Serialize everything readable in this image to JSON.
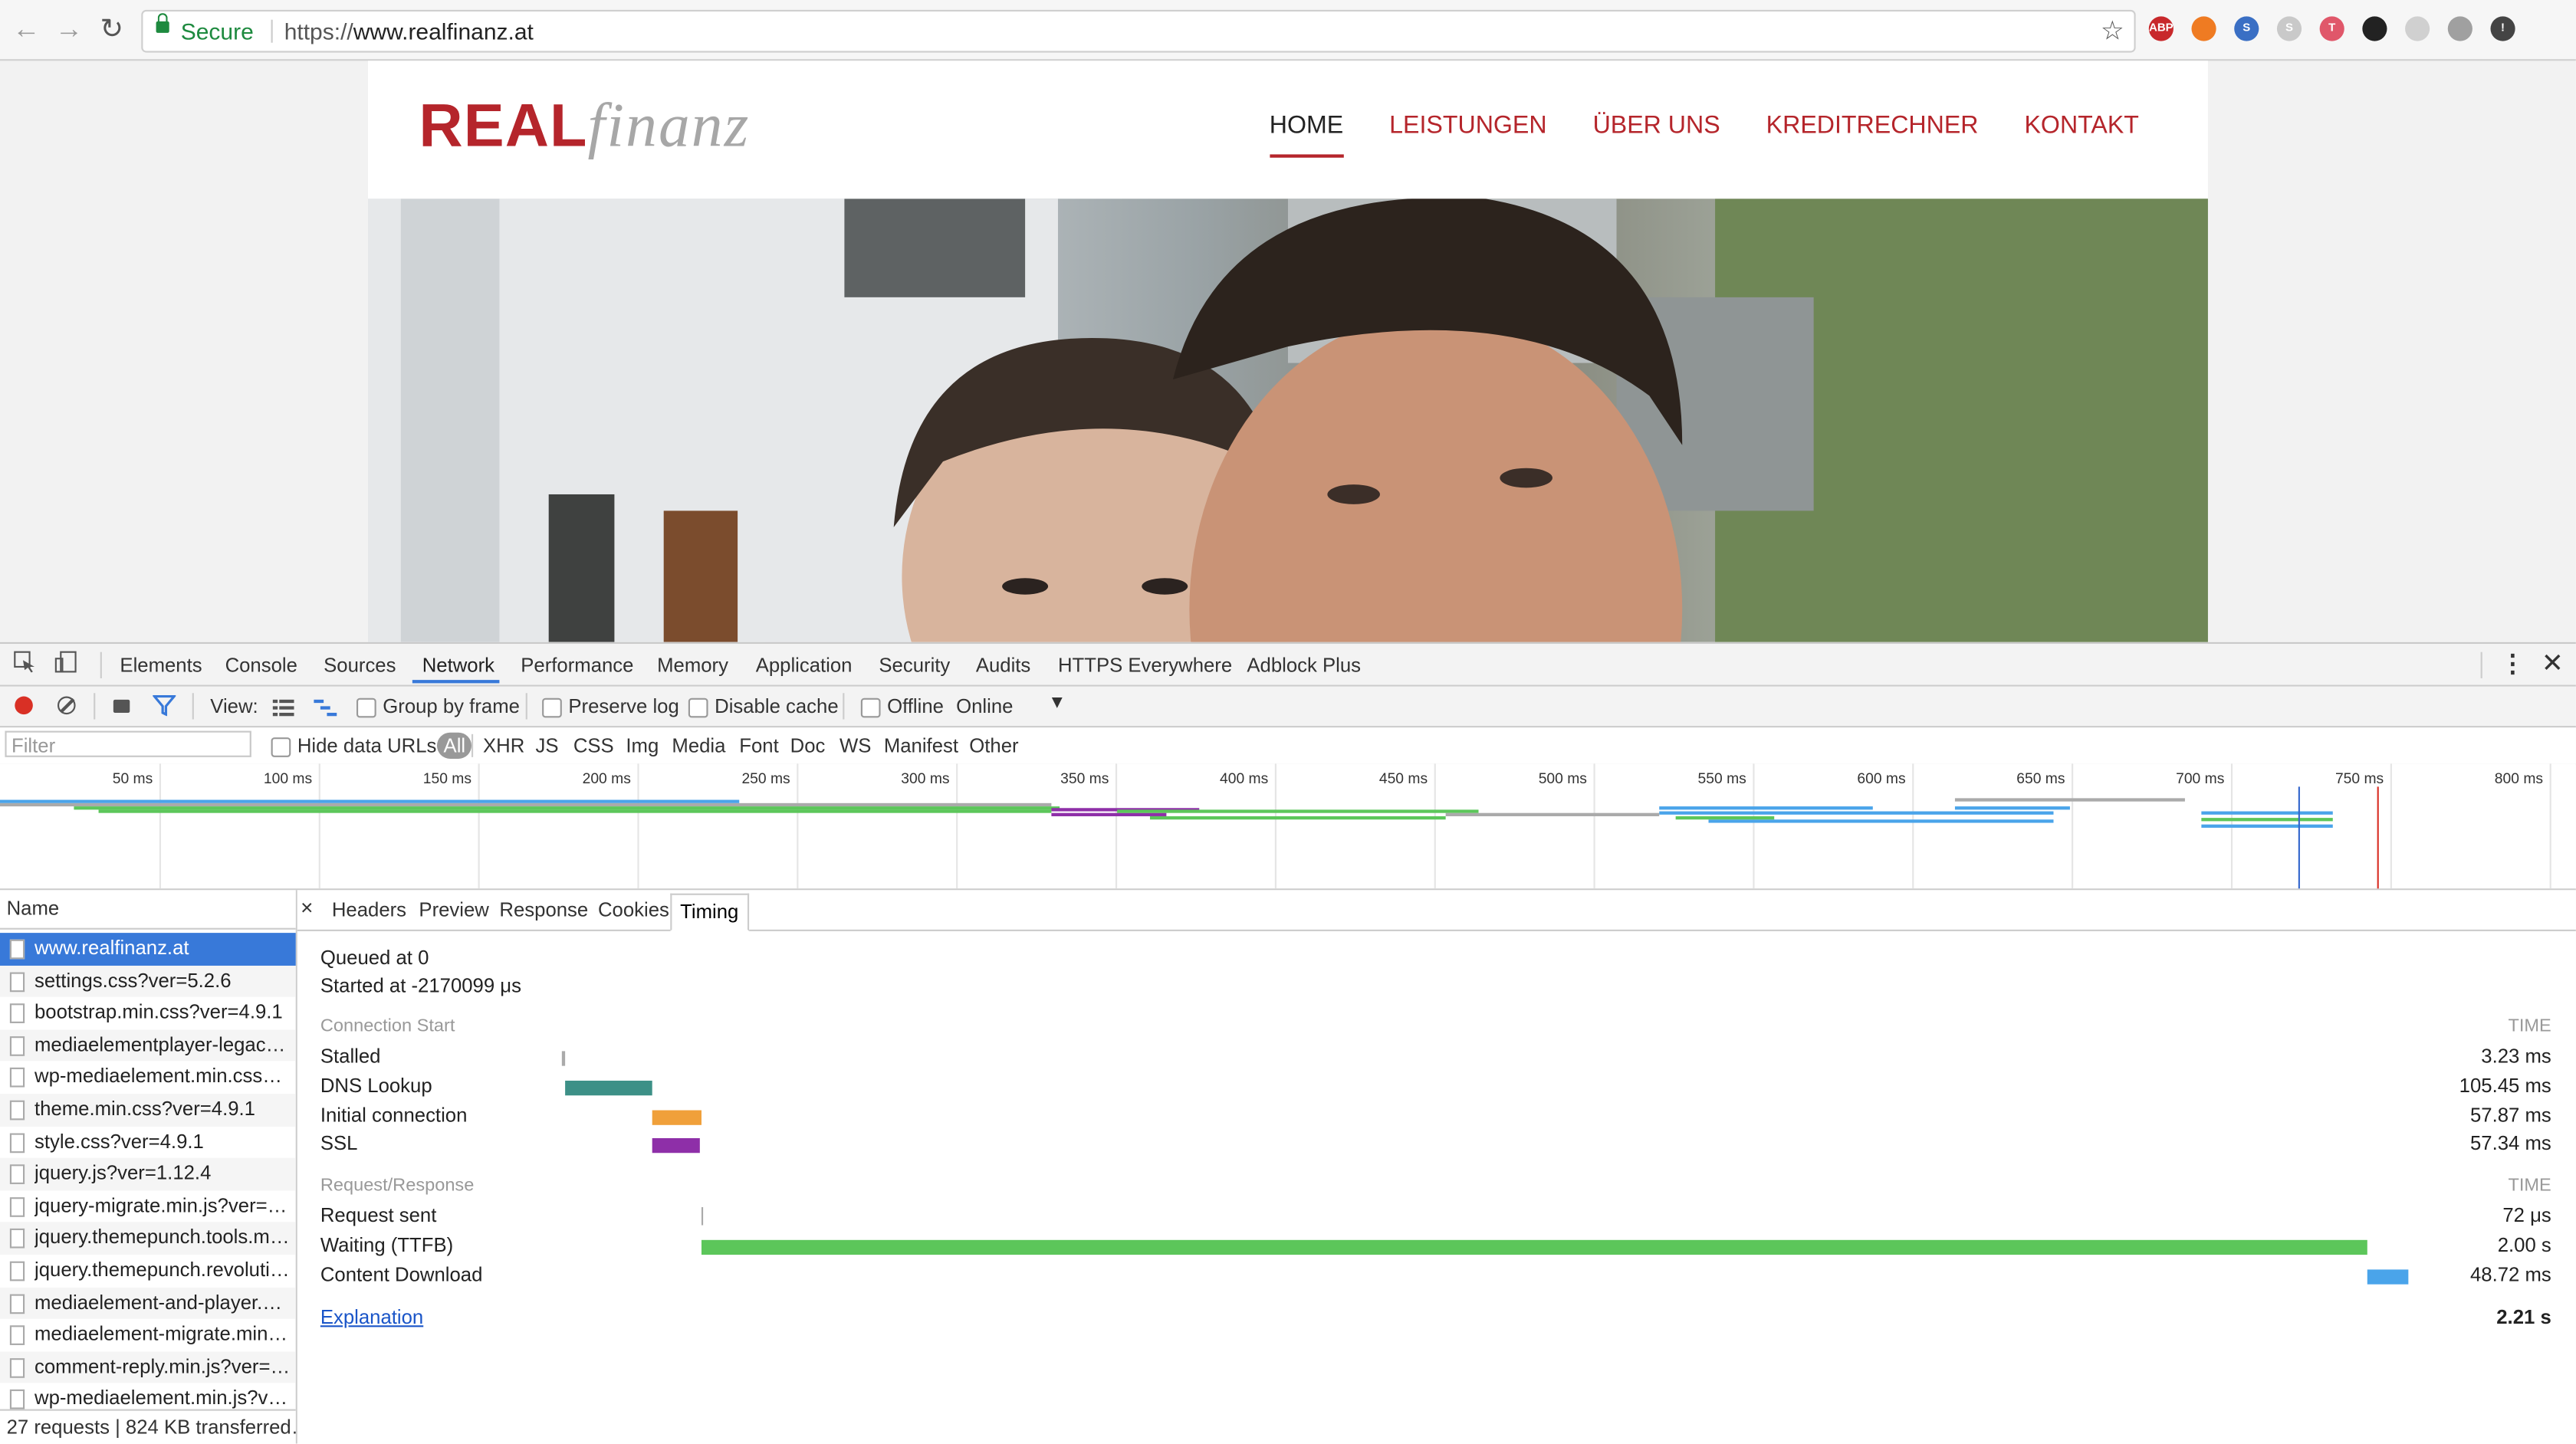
{
  "browser": {
    "secure_label": "Secure",
    "url_protocol": "https://",
    "url_host": "www.realfinanz.at",
    "extensions": [
      {
        "name": "abp-icon",
        "label": "ABP",
        "color": "#c8282b"
      },
      {
        "name": "extension-orange-icon",
        "label": "",
        "color": "#ef7b22"
      },
      {
        "name": "extension-s-icon",
        "label": "S",
        "color": "#3a6fc4"
      },
      {
        "name": "extension-skype-icon",
        "label": "S",
        "color": "#c9c9c9"
      },
      {
        "name": "extension-t-icon",
        "label": "T",
        "color": "#e0576a"
      },
      {
        "name": "extension-fox-icon",
        "label": "",
        "color": "#222222"
      },
      {
        "name": "extension-grid-icon",
        "label": "",
        "color": "#d0d0d0"
      },
      {
        "name": "extension-gear-icon",
        "label": "",
        "color": "#a0a0a0"
      },
      {
        "name": "extension-info-icon",
        "label": "!",
        "color": "#444444"
      }
    ]
  },
  "site": {
    "logo_bold": "REAL",
    "logo_light": "finanz",
    "nav": [
      "HOME",
      "LEISTUNGEN",
      "ÜBER UNS",
      "KREDITRECHNER",
      "KONTAKT"
    ],
    "accent": "#b5252b"
  },
  "devtools": {
    "tabs": [
      "Elements",
      "Console",
      "Sources",
      "Network",
      "Performance",
      "Memory",
      "Application",
      "Security",
      "Audits",
      "HTTPS Everywhere",
      "Adblock Plus"
    ],
    "active_tab": "Network",
    "toolbar": {
      "view_label": "View:",
      "group_by_frame": "Group by frame",
      "preserve_log": "Preserve log",
      "disable_cache": "Disable cache",
      "offline": "Offline",
      "throttle": "Online"
    },
    "filter": {
      "placeholder": "Filter",
      "hide_data_urls": "Hide data URLs",
      "types": [
        "All",
        "XHR",
        "JS",
        "CSS",
        "Img",
        "Media",
        "Font",
        "Doc",
        "WS",
        "Manifest",
        "Other"
      ]
    },
    "overview_ticks": [
      "50 ms",
      "100 ms",
      "150 ms",
      "200 ms",
      "250 ms",
      "300 ms",
      "350 ms",
      "400 ms",
      "450 ms",
      "500 ms",
      "550 ms",
      "600 ms",
      "650 ms",
      "700 ms",
      "750 ms",
      "800 ms"
    ],
    "name_header": "Name",
    "requests": [
      "www.realfinanz.at",
      "settings.css?ver=5.2.6",
      "bootstrap.min.css?ver=4.9.1",
      "mediaelementplayer-legacy.…",
      "wp-mediaelement.min.css?…",
      "theme.min.css?ver=4.9.1",
      "style.css?ver=4.9.1",
      "jquery.js?ver=1.12.4",
      "jquery-migrate.min.js?ver=1…",
      "jquery.themepunch.tools.mi…",
      "jquery.themepunch.revolutio…",
      "mediaelement-and-player.mi…",
      "mediaelement-migrate.min.j…",
      "comment-reply.min.js?ver=4…",
      "wp-mediaelement.min.js?ve…"
    ],
    "summary": "27 requests | 824 KB transferred…",
    "detail_tabs": [
      "Headers",
      "Preview",
      "Response",
      "Cookies",
      "Timing"
    ],
    "timing": {
      "queued": "Queued at 0",
      "started": "Started at -2170099 μs",
      "connection_heading": "Connection Start",
      "time_heading": "TIME",
      "connection_rows": [
        {
          "label": "Stalled",
          "value": "3.23 ms",
          "color": "#aaaaaa",
          "start_ms": 0,
          "duration_ms": 3.23
        },
        {
          "label": "DNS Lookup",
          "value": "105.45 ms",
          "color": "#3d9087",
          "start_ms": 3.23,
          "duration_ms": 105.45
        },
        {
          "label": "Initial connection",
          "value": "57.87 ms",
          "color": "#f0a03a",
          "start_ms": 108.68,
          "duration_ms": 57.87
        },
        {
          "label": "SSL",
          "value": "57.34 ms",
          "color": "#8e2fa8",
          "start_ms": 108.68,
          "duration_ms": 57.34
        }
      ],
      "request_heading": "Request/Response",
      "request_rows": [
        {
          "label": "Request sent",
          "value": "72 μs",
          "color": "#aaaaaa",
          "start_ms": 166.55,
          "duration_ms": 0.072
        },
        {
          "label": "Waiting (TTFB)",
          "value": "2.00 s",
          "color": "#5cc65a",
          "start_ms": 166.6,
          "duration_ms": 2000
        },
        {
          "label": "Content Download",
          "value": "48.72 ms",
          "color": "#4aa4ea",
          "start_ms": 2166.6,
          "duration_ms": 48.72
        }
      ],
      "explanation": "Explanation",
      "total": "2.21 s",
      "total_ms": 2215.3
    }
  }
}
